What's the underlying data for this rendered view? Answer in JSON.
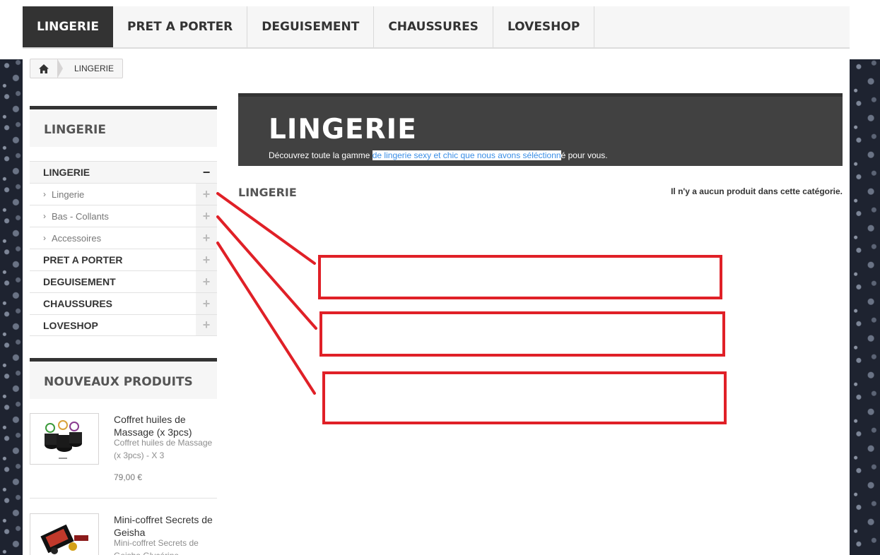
{
  "topnav": {
    "items": [
      {
        "label": "LINGERIE",
        "active": true
      },
      {
        "label": "PRET A PORTER"
      },
      {
        "label": "DEGUISEMENT"
      },
      {
        "label": "CHAUSSURES"
      },
      {
        "label": "LOVESHOP"
      }
    ]
  },
  "breadcrumb": {
    "home_icon": "home-icon",
    "current": "LINGERIE"
  },
  "categories_block": {
    "title": "LINGERIE",
    "items": [
      {
        "label": "LINGERIE",
        "toggle": "−"
      },
      {
        "label": "Lingerie",
        "toggle": "+"
      },
      {
        "label": "Bas - Collants",
        "toggle": "+"
      },
      {
        "label": "Accessoires",
        "toggle": "+"
      },
      {
        "label": "PRET A PORTER",
        "toggle": "+"
      },
      {
        "label": "DEGUISEMENT",
        "toggle": "+"
      },
      {
        "label": "CHAUSSURES",
        "toggle": "+"
      },
      {
        "label": "LOVESHOP",
        "toggle": "+"
      }
    ]
  },
  "new_products": {
    "title": "NOUVEAUX PRODUITS",
    "items": [
      {
        "name": "Coffret huiles de Massage (x 3pcs)",
        "desc": "Coffret huiles de Massage (x 3pcs) - X 3",
        "price": "79,00 €"
      },
      {
        "name": "Mini-coffret Secrets de Geisha",
        "desc": "Mini-coffret Secrets de Geisha Glycérine"
      }
    ]
  },
  "hero": {
    "title": "LINGERIE",
    "desc_before": "Découvrez toute la gamme ",
    "desc_highlight": "de lingerie sexy et chic que nous avons séléctionn",
    "desc_after": "é pour vous."
  },
  "main": {
    "section_title": "LINGERIE",
    "empty_message": "Il n'y a aucun produit dans cette catégorie."
  },
  "colors": {
    "annotation": "#e02027",
    "active_nav": "#333333",
    "hero_bg": "#414141",
    "highlight_text": "#3a8ee6"
  }
}
